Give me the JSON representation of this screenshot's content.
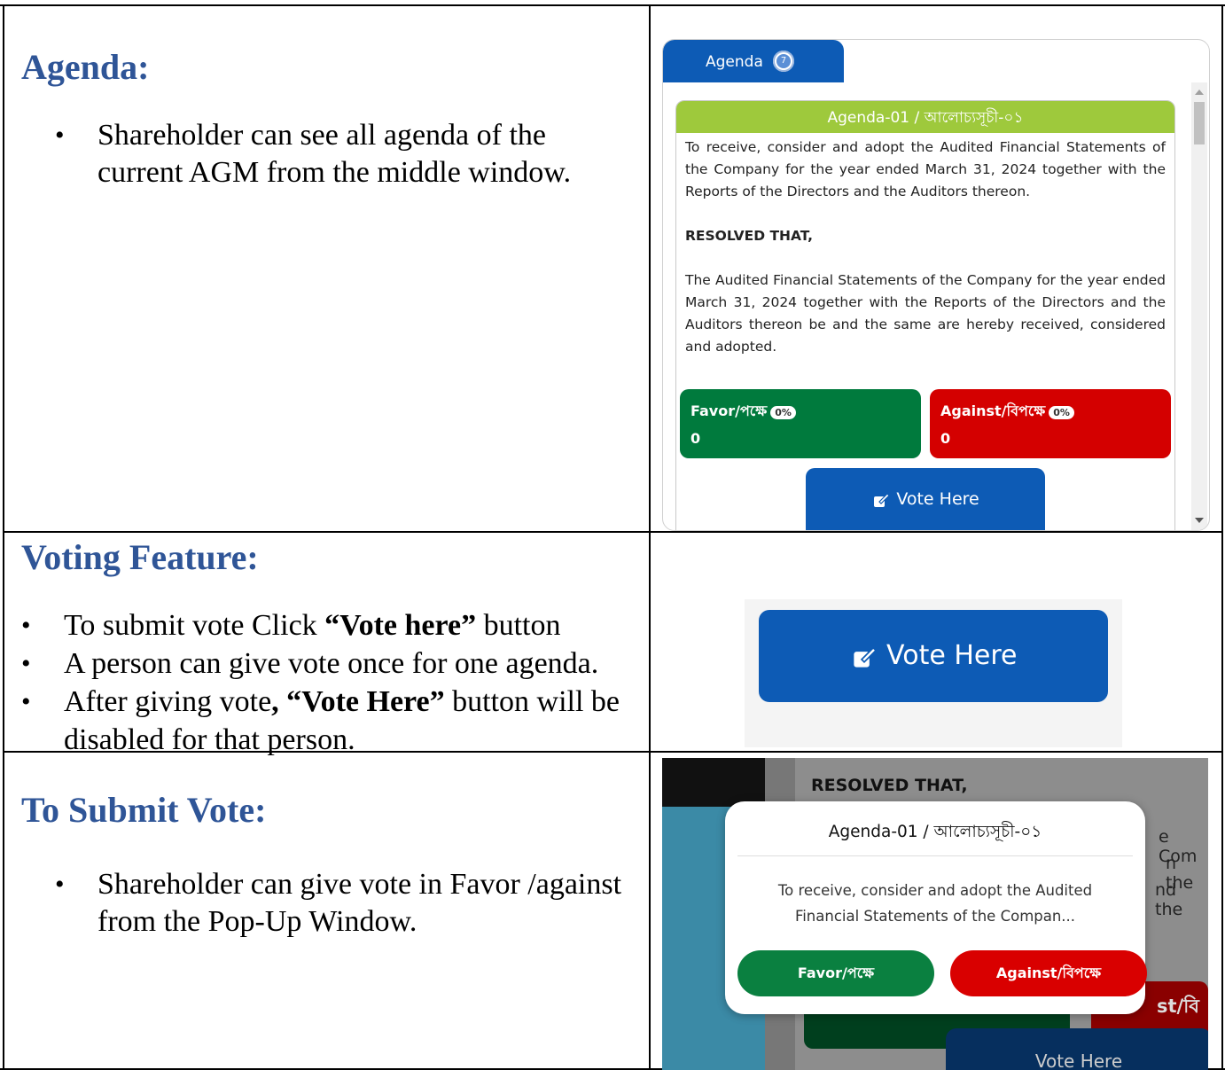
{
  "sections": [
    {
      "heading": "Agenda:",
      "bullets": [
        "Shareholder can see all agenda of the current AGM from the middle window."
      ]
    },
    {
      "heading": "Voting Feature:",
      "bullets": [
        {
          "pre": "To submit vote Click ",
          "bold": "“Vote here”",
          "post": " button"
        },
        {
          "pre": "A person can give vote once for one agenda.",
          "bold": "",
          "post": ""
        },
        {
          "pre": "After giving vote",
          "bold": ", “Vote Here”",
          "post": " button will be disabled for that person."
        }
      ]
    },
    {
      "heading": "To Submit Vote:",
      "bullets": [
        "Shareholder can give vote in Favor /against from the Pop-Up Window."
      ]
    }
  ],
  "panel1": {
    "tab_label": "Agenda",
    "tab_badge": "7",
    "agenda_title": "Agenda-01 / আলোচ্যসূচী-০১",
    "para1": "To receive, consider and adopt the Audited Financial Statements of the Company for the year ended March 31, 2024 together with the Reports of the Directors and the Auditors thereon.",
    "resolved": "RESOLVED THAT,",
    "para2": "The Audited Financial Statements of the Company for the year ended March 31, 2024 together with the Reports of the Directors and the Auditors thereon be and the same are hereby received, considered and adopted.",
    "favor_label": "Favor/পক্ষে",
    "favor_pct": "0%",
    "favor_count": "0",
    "against_label": "Against/বিপক্ষে",
    "against_pct": "0%",
    "against_count": "0",
    "vote_button": "Vote Here",
    "colors": {
      "tab": "#0d5bb5",
      "header": "#9ec93c",
      "favor": "#007a3d",
      "against": "#d40000"
    }
  },
  "panel2": {
    "vote_button": "Vote Here"
  },
  "panel3": {
    "resolved": "RESOLVED THAT,",
    "frag1": "e Com",
    "frag2": "n the",
    "frag3": "nd the",
    "frag4": "st/বি",
    "vote_button_bg": "Vote Here",
    "modal_title": "Agenda-01 / আলোচ্যসূচী-০১",
    "modal_body": "To receive, consider and adopt the Audited Financial Statements of the Compan...",
    "favor_button": "Favor/পক্ষে",
    "against_button": "Against/বিপক্ষে"
  }
}
